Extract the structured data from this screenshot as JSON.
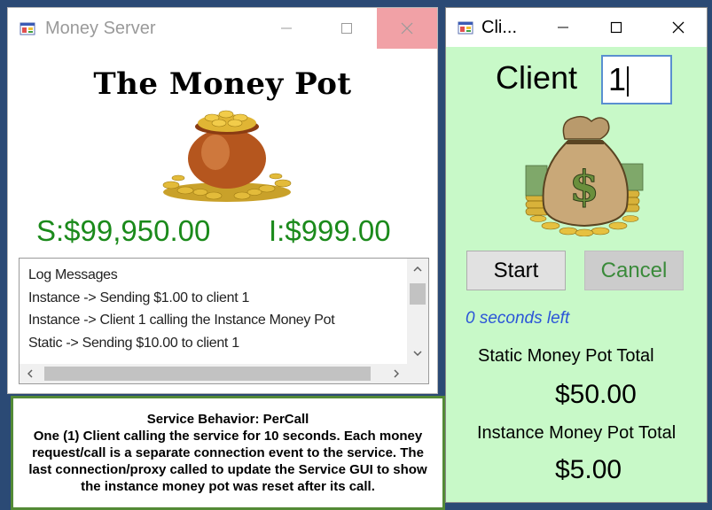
{
  "server_window": {
    "title": "Money Server",
    "heading": "The Money Pot",
    "static_amount": "S:$99,950.00",
    "instance_amount": "I:$999.00",
    "log": {
      "lines": [
        "Log Messages",
        "Instance -> Sending $1.00 to client 1",
        "Instance -> Client 1 calling the Instance Money Pot",
        "Static -> Sending $10.00 to client 1"
      ]
    }
  },
  "caption": {
    "title": "Service Behavior: PerCall",
    "body": "One (1) Client calling the service for 10 seconds. Each money request/call is a separate connection event to the service. The last connection/proxy called to update the Service GUI to show the instance money pot was reset after its call."
  },
  "client_window": {
    "title": "Cli...",
    "client_label": "Client",
    "client_number": "1",
    "start_label": "Start",
    "cancel_label": "Cancel",
    "seconds_left": "0 seconds left",
    "static_total_label": "Static Money Pot Total",
    "static_total_value": "$50.00",
    "instance_total_label": "Instance Money Pot Total",
    "instance_total_value": "$5.00"
  },
  "colors": {
    "amount_green": "#1b8a1b",
    "client_bg": "#c8f9c8",
    "close_hover": "#f1a1a6",
    "seconds_blue": "#2b55d8",
    "caption_border": "#538a36"
  },
  "icons": [
    "app-icon",
    "minimize-icon",
    "maximize-icon",
    "close-icon",
    "money-pot-image",
    "money-bag-image"
  ]
}
